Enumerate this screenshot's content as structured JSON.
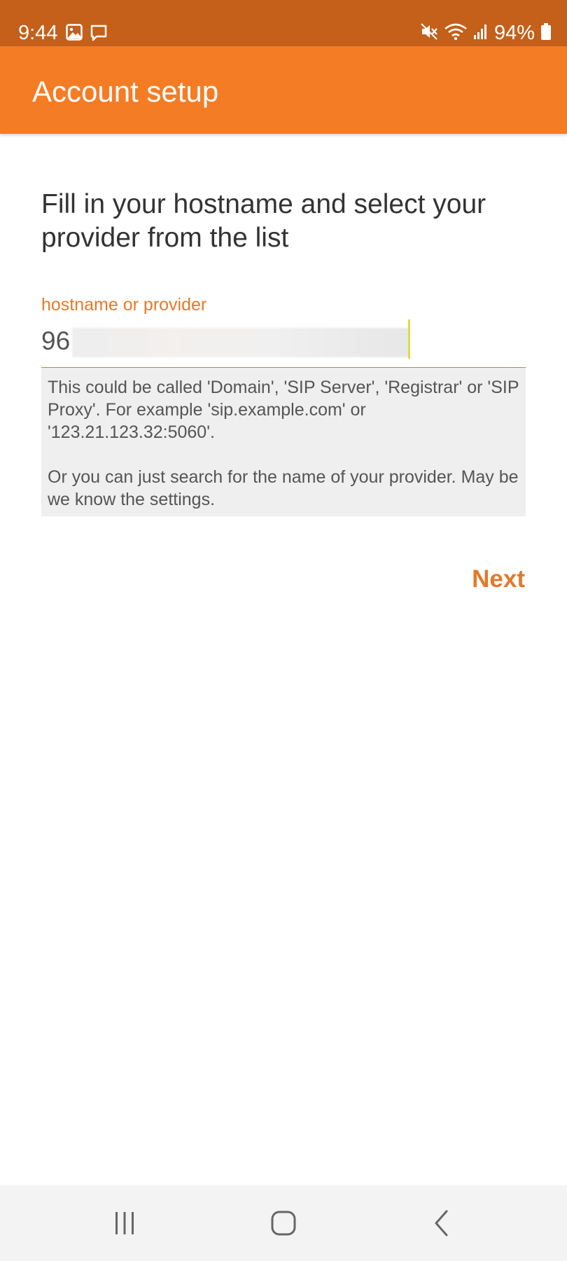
{
  "status_bar": {
    "time": "9:44",
    "battery": "94%",
    "icons": [
      "image-icon",
      "message-icon",
      "mute-icon",
      "wifi-icon",
      "signal-icon",
      "battery-icon"
    ]
  },
  "app_bar": {
    "title": "Account setup",
    "color": "#f47c25"
  },
  "main": {
    "headline": "Fill in your hostname and select your provider from the list",
    "field": {
      "label": "hostname or provider",
      "value": "96"
    },
    "hint": "This could be called 'Domain', 'SIP Server', 'Registrar' or 'SIP Proxy'. For example 'sip.example.com' or '123.21.123.32:5060'.\n\nOr you can just search for the name of your provider. May be we know the settings.",
    "next_label": "Next",
    "accent": "#e37a2b"
  },
  "nav_bar": {
    "icons": [
      "recent-apps-icon",
      "home-icon",
      "back-icon"
    ]
  }
}
